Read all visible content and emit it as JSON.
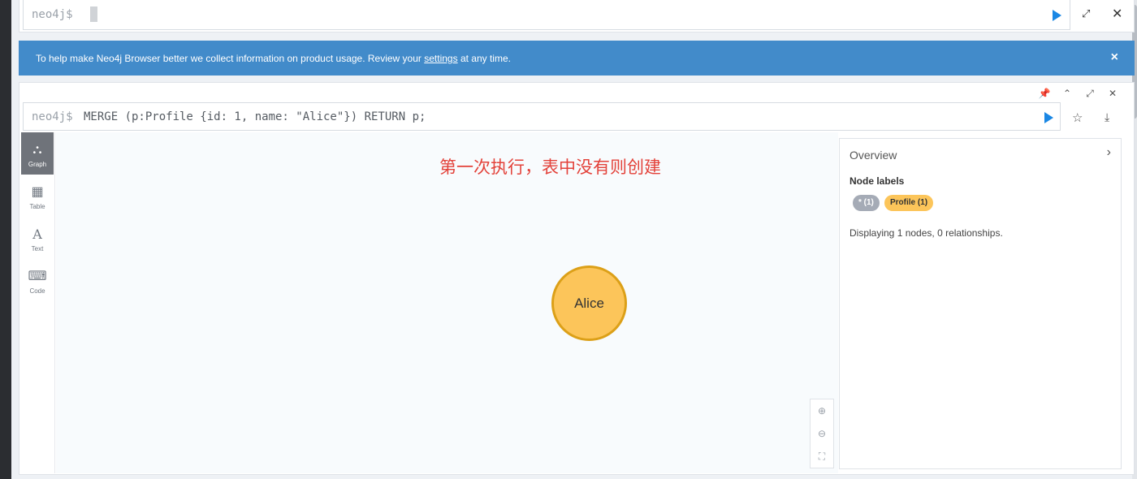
{
  "top_editor": {
    "prompt": "neo4j$"
  },
  "banner": {
    "text_before": "To help make Neo4j Browser better we collect information on product usage. Review your ",
    "link": "settings",
    "text_after": " at any time.",
    "close": "×"
  },
  "frame": {
    "controls": [
      "pin-icon",
      "chevron-up-icon",
      "expand-icon",
      "close-icon"
    ],
    "query_prefix": "neo4j$",
    "query": "MERGE (p:Profile {id: 1, name: \"Alice\"}) RETURN p;",
    "nav": [
      {
        "label": "Graph",
        "icon": "graph-icon",
        "active": true
      },
      {
        "label": "Table",
        "icon": "table-icon",
        "active": false
      },
      {
        "label": "Text",
        "icon": "text-icon",
        "active": false
      },
      {
        "label": "Code",
        "icon": "code-icon",
        "active": false
      }
    ],
    "annotation": "第一次执行，表中没有则创建",
    "node": {
      "label": "Alice",
      "color": "#fcc55a",
      "border": "#dca018"
    },
    "overview": {
      "title": "Overview",
      "section": "Node labels",
      "pills": [
        {
          "label": "* (1)",
          "color": "#a5abb6"
        },
        {
          "label": "Profile (1)",
          "color": "#fcc55a"
        }
      ],
      "info": "Displaying 1 nodes, 0 relationships."
    }
  },
  "colors": {
    "banner": "#428bca",
    "play": "#1a87e4",
    "annotation": "#e3423a"
  }
}
